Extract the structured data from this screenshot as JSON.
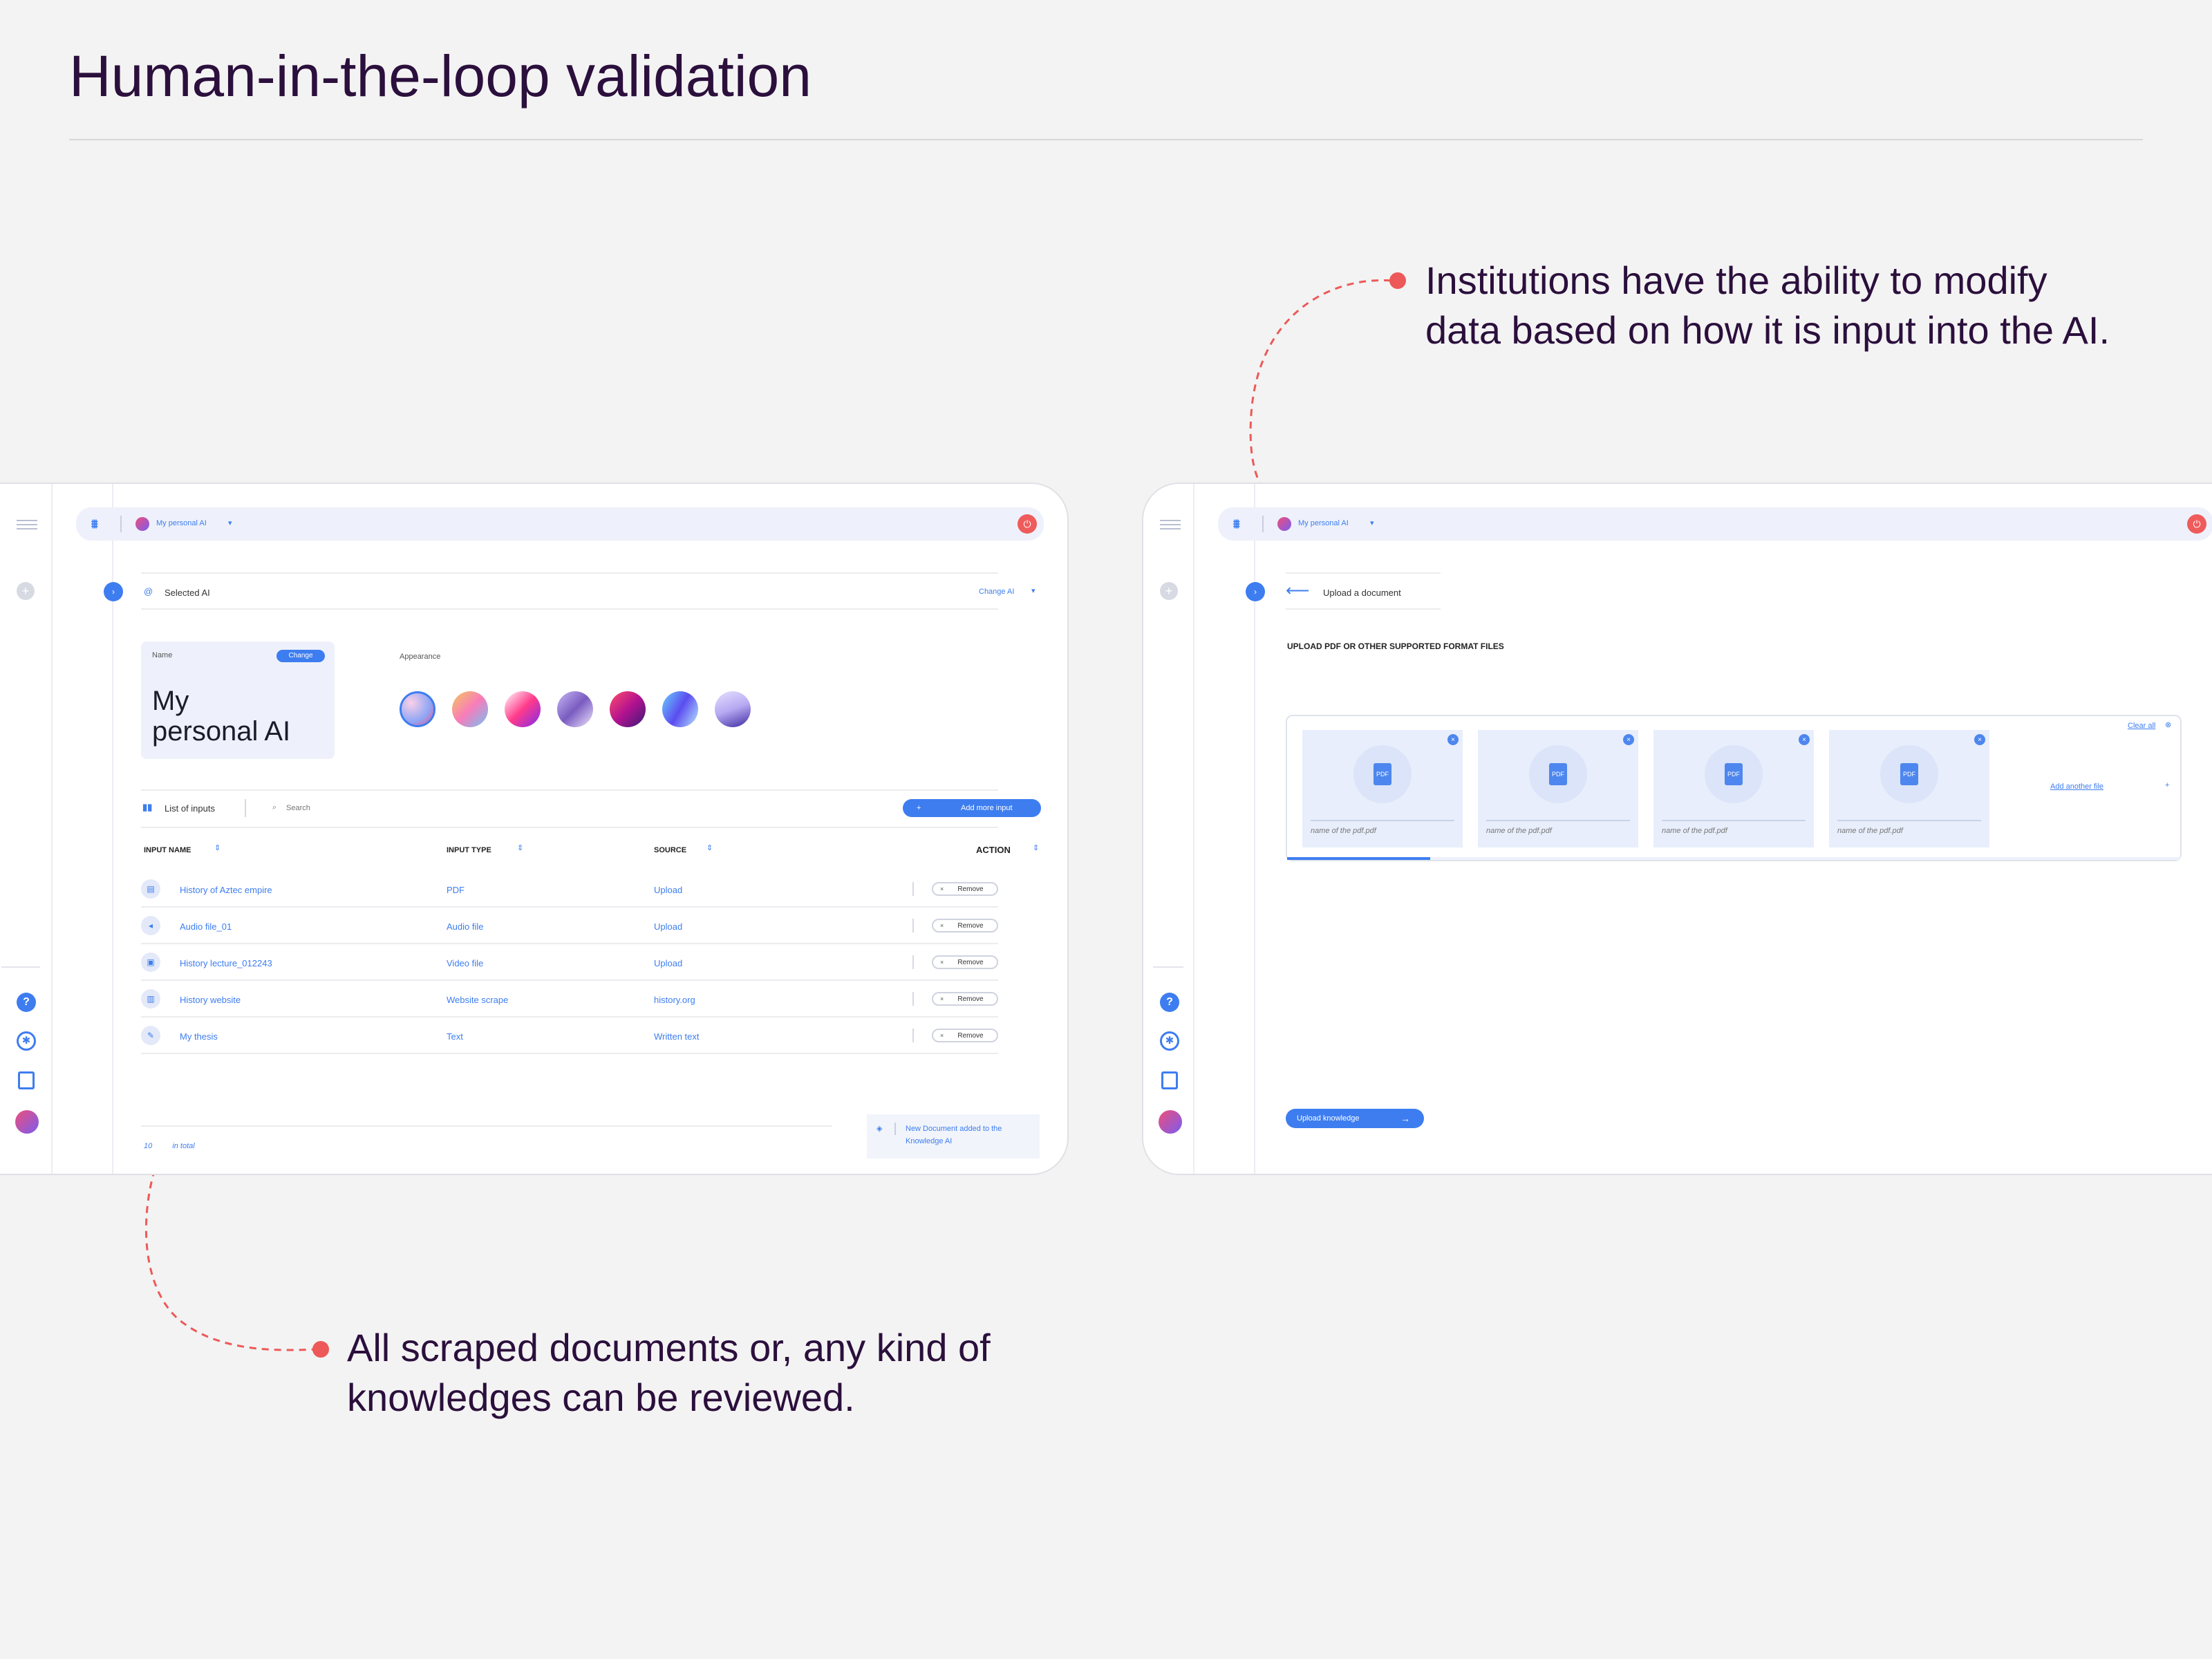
{
  "page": {
    "title": "Human-in-the-loop validation",
    "callout_top_line1": "Institutions have the ability to modify",
    "callout_top_line2": "data based on how it is input into the AI.",
    "callout_bottom_line1": "All scraped documents or, any kind of",
    "callout_bottom_line2": "knowledges can be reviewed."
  },
  "colors": {
    "accent": "#3d7df0",
    "annotation": "#ec5958",
    "title": "#2b0f3c"
  },
  "left_screen": {
    "topbar": {
      "ai_name": "My personal AI"
    },
    "selected": {
      "label": "Selected AI",
      "change": "Change AI"
    },
    "name_card": {
      "label": "Name",
      "change_btn": "Change",
      "value_line1": "My",
      "value_line2": "personal AI"
    },
    "appearance": {
      "label": "Appearance",
      "swatch_count": 7
    },
    "inputs": {
      "label": "List of inputs",
      "search_placeholder": "Search",
      "add_button": "Add more input",
      "columns": [
        "INPUT NAME",
        "INPUT TYPE",
        "SOURCE",
        "ACTION"
      ],
      "rows": [
        {
          "name": "History of Aztec empire",
          "type": "PDF",
          "source": "Upload",
          "action": "Remove"
        },
        {
          "name": "Audio file_01",
          "type": "Audio file",
          "source": "Upload",
          "action": "Remove"
        },
        {
          "name": "History lecture_012243",
          "type": "Video file",
          "source": "Upload",
          "action": "Remove"
        },
        {
          "name": "History website",
          "type": "Website scrape",
          "source": "history.org",
          "action": "Remove"
        },
        {
          "name": "My thesis",
          "type": "Text",
          "source": "Written text",
          "action": "Remove"
        }
      ],
      "total_prefix": "10",
      "total_suffix": "in total"
    },
    "toast": {
      "line1": "New Document added to the",
      "line2": "Knowledge AI"
    }
  },
  "right_screen": {
    "topbar": {
      "ai_name": "My personal AI"
    },
    "header": {
      "back_label": "Upload a document"
    },
    "upload_title": "UPLOAD PDF OR OTHER SUPPORTED FORMAT FILES",
    "clear_all": "Clear all",
    "files": [
      {
        "name": "name of the pdf.pdf",
        "badge": "PDF"
      },
      {
        "name": "name of the pdf.pdf",
        "badge": "PDF"
      },
      {
        "name": "name of the pdf.pdf",
        "badge": "PDF"
      },
      {
        "name": "name of the pdf.pdf",
        "badge": "PDF"
      }
    ],
    "add_another": "Add another file",
    "upload_button": "Upload knowledge",
    "upload_progress": 0.16
  }
}
